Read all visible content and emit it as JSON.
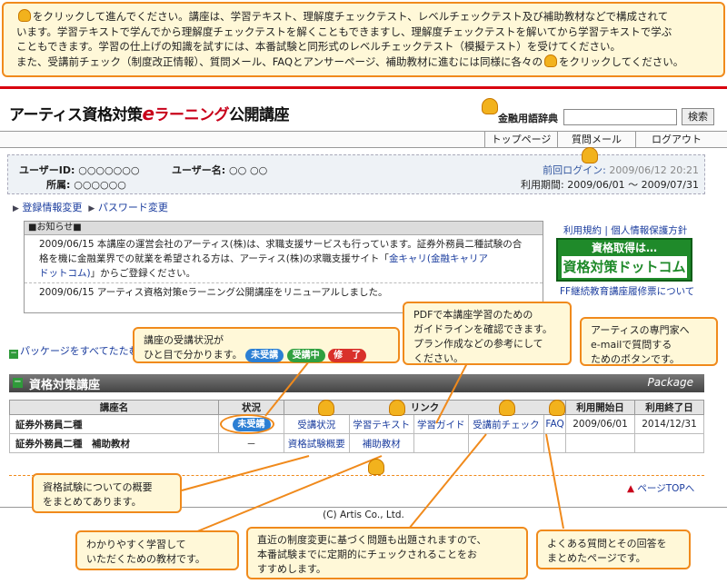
{
  "top_note": {
    "line1": "をクリックして進んでください。講座は、学習テキスト、理解度チェックテスト、レベルチェックテスト及び補助教材などで構成されて",
    "line2": "います。学習テキストで学んでから理解度チェックテストを解くこともできますし、理解度チェックテストを解いてから学習テキストで学ぶ",
    "line3": "こともできます。学習の仕上げの知識を試すには、本番試験と同形式のレベルチェックテスト（模擬テスト）を受けてください。",
    "line4a": "また、受講前チェック（制度改正情報）、質問メール、FAQとアンサーページ、補助教材に進むには同様に各々の",
    "line4b": "をクリックしてください。"
  },
  "header": {
    "logo_a": "アーティス資格対策",
    "logo_e": "e",
    "logo_b": "ラーニング",
    "logo_c": "公開講座",
    "dict_label": "金融用語辞典",
    "search_label": "検索"
  },
  "nav": {
    "top": "トップページ",
    "question": "質問メール",
    "logout": "ログアウト"
  },
  "user": {
    "id": "ユーザーID: ○○○○○○○",
    "name": "ユーザー名: ○○ ○○",
    "org": "所属: ○○○○○○",
    "last_login_label": "前回ログイン:",
    "last_login_value": "2009/06/12 20:21",
    "period": "利用期間: 2009/06/01 ～ 2009/07/31",
    "link_reg": "登録情報変更",
    "link_pw": "パスワード変更"
  },
  "news": {
    "heading": "■お知らせ■",
    "item1a": "2009/06/15 本講座の運営会社のアーティス(株)は、求職支援サービスも行っています。証券外務員二種試験の合",
    "item1b": "格を機に金融業界での就業を希望される方は、アーティス(株)の求職支援サイト「",
    "item1link": "金キャリ(金融キャリア",
    "item1c": "ドットコム)",
    "item1d": "」からご登録ください。",
    "item2": "2009/06/15 アーティス資格対策eラーニング公開講座をリニューアルしました。"
  },
  "side": {
    "terms": "利用規約",
    "sep": "|",
    "privacy": "個人情報保護方針",
    "banner1": "資格取得は…",
    "banner2": "資格対策ドットコム",
    "ff": "FF継続教育講座履修票について"
  },
  "collapse_all": "パッケージをすべてたたむ",
  "section": {
    "title": "資格対策講座",
    "package": "Package"
  },
  "table": {
    "headers": [
      "講座名",
      "状況",
      "リンク",
      "利用開始日",
      "利用終了日"
    ],
    "row1": {
      "name": "証券外務員二種",
      "status": "未受講",
      "l1": "受講状況",
      "l2": "学習テキスト",
      "l3": "学習ガイド",
      "l4": "受講前チェック",
      "l5": "FAQ",
      "start": "2009/06/01",
      "end": "2014/12/31"
    },
    "row2": {
      "name": "証券外務員二種　補助教材",
      "status": "－",
      "l1": "資格試験概要",
      "l2": "補助教材"
    }
  },
  "page_top": "ページTOPへ",
  "copyright": "(C) Artis Co., Ltd.",
  "callouts": {
    "status1": "講座の受講状況が",
    "status2": "ひと目で分かります。",
    "badge_a": "未受講",
    "badge_b": "受講中",
    "badge_c": "修　了",
    "guide1": "PDFで本講座学習のための",
    "guide2": "ガイドラインを確認できます。",
    "guide3": "プラン作成などの参考にして",
    "guide4": "ください。",
    "mail1": "アーティスの専門家へ",
    "mail2": "e-mailで質問する",
    "mail3": "ためのボタンです。",
    "overview1": "資格試験についての概要",
    "overview2": "をまとめてあります。",
    "aux1": "わかりやすく学習して",
    "aux2": "いただくための教材です。",
    "check1": "直近の制度変更に基づく問題も出題されますので、",
    "check2": "本番試験までに定期的にチェックされることをお",
    "check3": "すすめします。",
    "faq1": "よくある質問とその回答を",
    "faq2": "まとめたページです。"
  },
  "colors": {
    "accent": "#f08a1c",
    "brand_red": "#d8000e",
    "link": "#1a3c9e",
    "banner_green": "#1f8a2a"
  }
}
